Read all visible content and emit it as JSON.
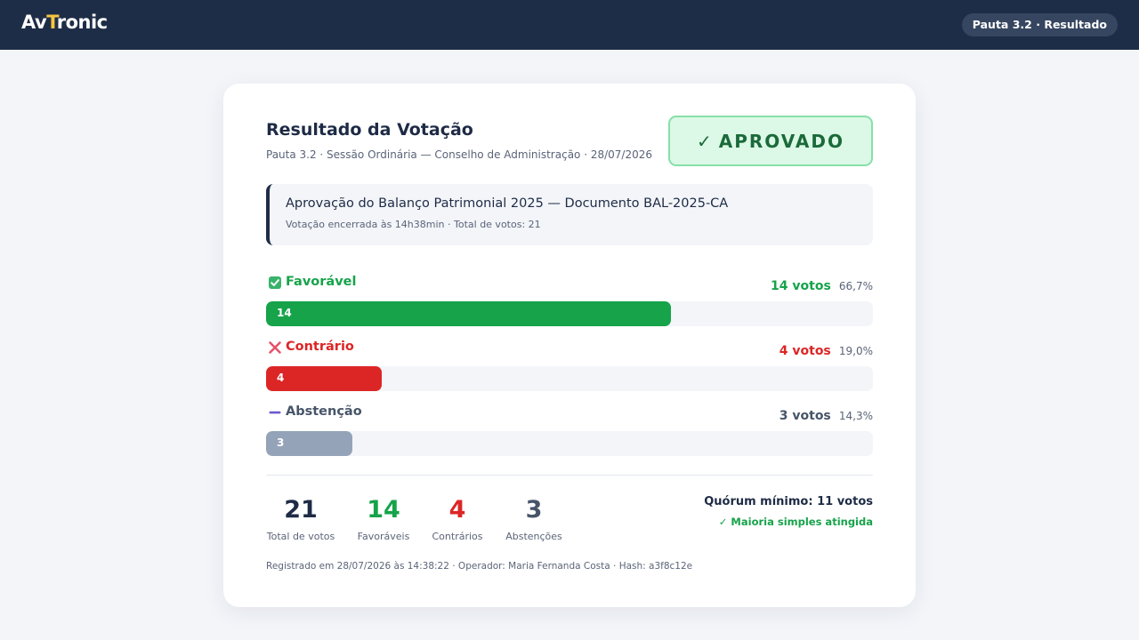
{
  "header": {
    "logo_part1": "Av",
    "logo_part2": "T",
    "logo_part3": "ronic",
    "badge": "Pauta 3.2 · Resultado"
  },
  "result": {
    "title": "Resultado da Votação",
    "subtitle": "Pauta 3.2 · Sessão Ordinária — Conselho de Administração · 28/07/2026",
    "status_check": "✓",
    "status": "APROVADO"
  },
  "motion": {
    "title": "Aprovação do Balanço Patrimonial 2025 — Documento BAL-2025-CA",
    "meta": "Votação encerrada às 14h38min · Total de votos: 21"
  },
  "options": [
    {
      "label": "Favorável",
      "icon": "check-square-icon",
      "votes_text": "14 votos",
      "pct": "66,7%",
      "bar_label": "14",
      "votes": 14,
      "color": "#16a34a"
    },
    {
      "label": "Contrário",
      "icon": "x-mark-icon",
      "votes_text": "4 votos",
      "pct": "19,0%",
      "bar_label": "4",
      "votes": 4,
      "color": "#dc2626"
    },
    {
      "label": "Abstenção",
      "icon": "minus-icon",
      "votes_text": "3 votos",
      "pct": "14,3%",
      "bar_label": "3",
      "votes": 3,
      "color": "#94a3b8"
    }
  ],
  "totals": {
    "total_votes": 21,
    "stats": [
      {
        "value": "21",
        "label": "Total de votos",
        "color": "#1e2b45"
      },
      {
        "value": "14",
        "label": "Favoráveis",
        "color": "#16a34a"
      },
      {
        "value": "4",
        "label": "Contrários",
        "color": "#dc2626"
      },
      {
        "value": "3",
        "label": "Abstenções",
        "color": "#475569"
      }
    ],
    "quorum": "Quórum mínimo: 11 votos",
    "majority": "✓ Maioria simples atingida"
  },
  "footer": "Registrado em 28/07/2026 às 14:38:22 · Operador: Maria Fernanda Costa · Hash: a3f8c12e",
  "colors": {
    "topbar": "#1e2d47",
    "accent": "#f5c542",
    "approved_bg": "#dcf8e6",
    "approved_text": "#1b6a3a",
    "abstention_icon": "#6d5acd"
  }
}
